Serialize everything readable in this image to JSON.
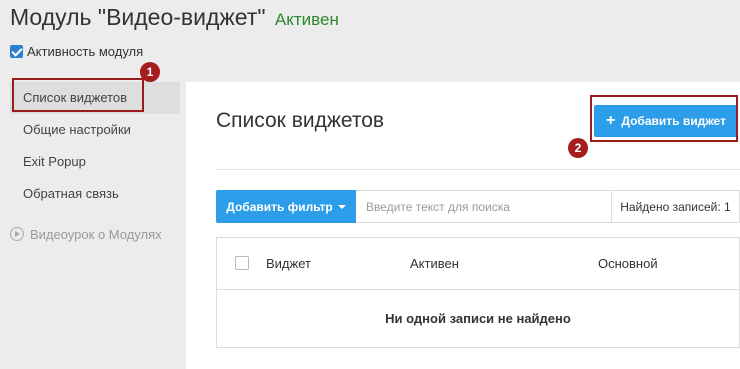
{
  "header": {
    "title": "Модуль \"Видео-виджет\"",
    "status": "Активен",
    "module_active_label": "Активность модуля"
  },
  "sidebar": {
    "items": [
      {
        "label": "Список виджетов",
        "active": true
      },
      {
        "label": "Общие настройки"
      },
      {
        "label": "Exit Popup"
      },
      {
        "label": "Обратная связь"
      }
    ],
    "video_link": "Видеоурок о Модулях"
  },
  "main": {
    "title": "Список виджетов",
    "add_button": "Добавить виджет",
    "filter_button": "Добавить фильтр",
    "search_placeholder": "Введите текст для поиска",
    "found_label": "Найдено записей: 1",
    "table": {
      "columns": [
        "Виджет",
        "Активен",
        "Основной"
      ],
      "empty_text": "Ни одной записи не найдено"
    }
  },
  "callouts": {
    "badge1": "1",
    "badge2": "2"
  },
  "colors": {
    "accent": "#2c9de8",
    "status_green": "#2c8a2c",
    "callout_red": "#9b1a1a"
  }
}
